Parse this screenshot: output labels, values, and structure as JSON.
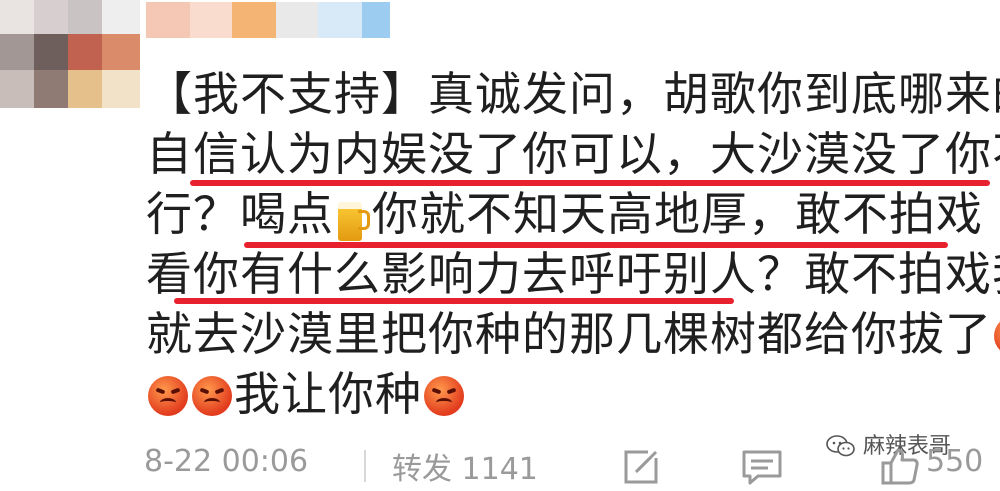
{
  "comment": {
    "lines": [
      "【我不支持】真诚发问，胡歌你到底哪来的",
      "自信认为内娱没了你可以，大沙漠没了你不",
      "行？喝点",
      "你就不知天高地厚，敢不拍戏",
      "看你有什么影响力去呼吁别人？敢不拍戏我",
      "就去沙漠里把你种的那几棵树都给你拔了",
      "我让你种"
    ]
  },
  "footer": {
    "time": "8-22 00:06",
    "forward": "转发 1141",
    "likes": "550"
  },
  "watermark": {
    "text": "麻辣表哥"
  },
  "icons": {
    "angry": "angry-face-icon",
    "beer": "beer-icon",
    "edit": "edit-icon",
    "comment": "comment-icon",
    "like": "thumbs-up-icon"
  },
  "colors": {
    "underline": "#e8212f",
    "meta": "#9a9a9a"
  }
}
